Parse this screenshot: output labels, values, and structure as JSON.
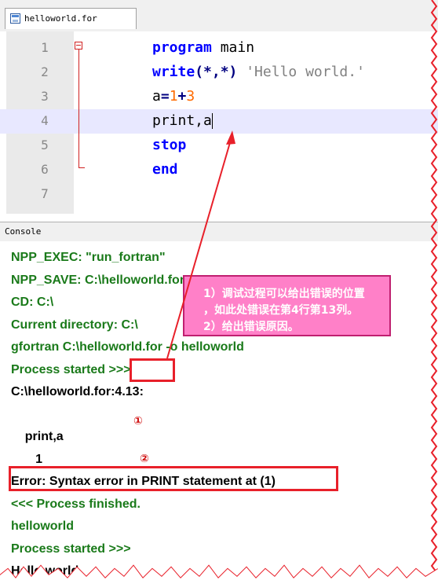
{
  "tab": {
    "label": "helloworld.for"
  },
  "editor": {
    "lines": [
      {
        "num": "1",
        "tokens": [
          [
            "kw",
            "program"
          ],
          [
            "plain",
            " main"
          ]
        ]
      },
      {
        "num": "2",
        "tokens": [
          [
            "kw",
            "write"
          ],
          [
            "op",
            "(*,*)"
          ],
          [
            "plain",
            " "
          ],
          [
            "str",
            "'Hello world.'"
          ]
        ]
      },
      {
        "num": "3",
        "tokens": [
          [
            "plain",
            "a"
          ],
          [
            "op",
            "="
          ],
          [
            "numlit",
            "1"
          ],
          [
            "op",
            "+"
          ],
          [
            "numlit",
            "3"
          ]
        ]
      },
      {
        "num": "4",
        "tokens": [
          [
            "plain",
            "print,a"
          ]
        ]
      },
      {
        "num": "5",
        "tokens": [
          [
            "kw",
            "stop"
          ]
        ]
      },
      {
        "num": "6",
        "tokens": [
          [
            "kw",
            "end"
          ]
        ]
      },
      {
        "num": "7",
        "tokens": []
      }
    ]
  },
  "console": {
    "title": "Console",
    "lines": [
      {
        "text": "NPP_EXEC: \"run_fortran\"",
        "color": "green"
      },
      {
        "text": "NPP_SAVE: C:\\helloworld.for",
        "color": "green"
      },
      {
        "text": "CD: C:\\",
        "color": "green"
      },
      {
        "text": "Current directory: C:\\",
        "color": "green"
      },
      {
        "text": "gfortran C:\\helloworld.for -o helloworld",
        "color": "green"
      },
      {
        "text": "Process started >>>",
        "color": "green"
      },
      {
        "text": "C:\\helloworld.for:4.13:",
        "color": "black"
      },
      {
        "text": "",
        "color": "black"
      },
      {
        "text": "    print,a",
        "color": "black"
      },
      {
        "text": "       1",
        "color": "black"
      },
      {
        "text": "Error: Syntax error in PRINT statement at (1)",
        "color": "black"
      },
      {
        "text": "<<< Process finished.",
        "color": "green"
      },
      {
        "text": "helloworld",
        "color": "green"
      },
      {
        "text": "Process started >>>",
        "color": "green"
      },
      {
        "text": "Hello world.",
        "color": "black"
      }
    ]
  },
  "annotations": {
    "note_line1": "1）调试过程可以给出错误的位置",
    "note_line2": "，如此处错误在第4行第13列。",
    "note_line3": "2）给出错误原因。",
    "mark1": "①",
    "mark2": "②"
  },
  "colors": {
    "keyword": "#0000ff",
    "console_green": "#1a7a1a",
    "annotation_red": "#e8202a",
    "note_pink": "#ff80c8"
  }
}
